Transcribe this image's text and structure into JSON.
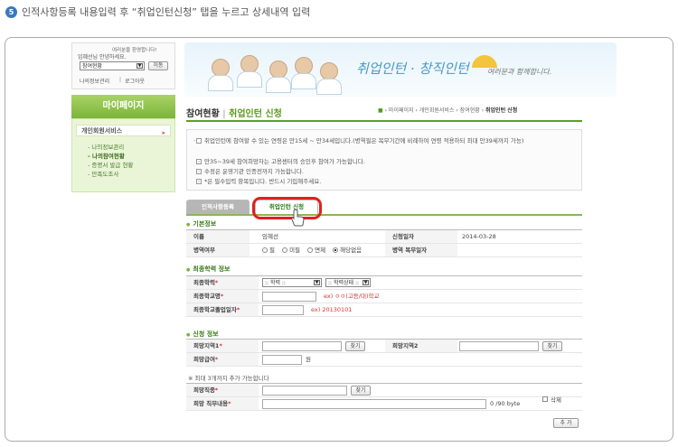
{
  "instruction": {
    "step_number": "5",
    "text": "인적사항등록 내용입력 후 “취업인턴신청” 탭을 누르고 상세내역 입력"
  },
  "login_box": {
    "welcome": "여러분을 환영합니다!",
    "greeting": "임혜선님 안녕하세요.",
    "select_value": "참여현황",
    "go_button": "이동",
    "info_link": "나의정보관리",
    "logout_link": "로그아웃"
  },
  "header_banner": {
    "slogan": "취업인턴 · 창직인턴",
    "slogan_sub": "여러분과 함께합니다."
  },
  "sidebar": {
    "title": "마이페이지",
    "section": "개인회원서비스",
    "items": [
      {
        "label": "- 나의정보관리",
        "active": false
      },
      {
        "label": "- 나의참여현황",
        "active": true
      },
      {
        "label": "- 증명서 발급 현황",
        "active": false
      },
      {
        "label": "- 만족도조사",
        "active": false
      }
    ]
  },
  "page": {
    "title": "참여현황",
    "subtitle": "취업인턴 신청",
    "separator": "|",
    "breadcrumb": [
      "마이페이지",
      "개인회원서비스",
      "참여현황",
      "취업인턴 신청"
    ]
  },
  "notices": [
    "취업인턴에 참여할 수 있는 연령은 만15세 ~ 만34세입니다.(병역필은 복무기간에 비례하여 연령 적용하되 최대 만39세까지 가능)",
    "만35~39세 참여희망자는 고용센터의 승인후 참여가 가능합니다.",
    "수정은 운영기관 인증전까지 가능합니다.",
    "*은 필수입력 항목입니다. 반드시 기입해주세요."
  ],
  "tabs": [
    {
      "label": "인적사항등록"
    },
    {
      "label": "취업인턴 신청"
    }
  ],
  "basic_info": {
    "section_title": "기본정보",
    "name_label": "이름",
    "name_value": "임혜선",
    "date_label": "신청일자",
    "date_value": "2014-03-28",
    "military_label": "병역여부",
    "military_options": [
      "필",
      "미필",
      "면제",
      "해당없음"
    ],
    "military_selected": "해당없음",
    "service_label": "병역 복무일자"
  },
  "education": {
    "section_title": "최종학력 정보",
    "level_label": "최종학력",
    "level_select": ":: 학력 ::",
    "status_select": ":: 학력상태 ::",
    "school_label": "최종학교명",
    "school_example": "ex) ㅇㅇ(고등/대)학교",
    "grad_label": "최종학교졸업일자",
    "grad_example": "ex) 20130101"
  },
  "application": {
    "section_title": "신청 정보",
    "region1_label": "희망지역1",
    "region2_label": "희망지역2",
    "search_button": "찾기",
    "salary_label": "희망급여",
    "salary_unit": "원",
    "job_note": "※ 최대 3개까지 추가 가능합니다",
    "job_label": "희망직종",
    "detail_label": "희망 직무내용",
    "byte_counter": "0  /90 byte",
    "delete_label": "삭제",
    "add_button": "추 가"
  }
}
